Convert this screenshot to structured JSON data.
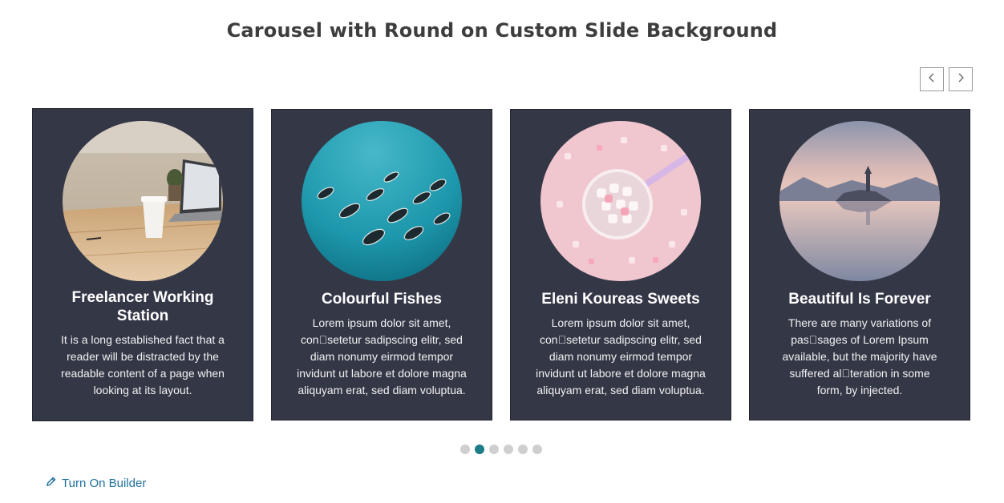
{
  "page": {
    "title": "Carousel with Round on Custom Slide Background"
  },
  "navigation": {
    "prev_icon": "chevron-left-icon",
    "next_icon": "chevron-right-icon"
  },
  "slides": [
    {
      "title": "Freelancer Working Station",
      "text": "It is a long established fact that a reader will be distracted by the readable content of a page when looking at its layout.",
      "image": "laptop-desk-photo"
    },
    {
      "title": "Colourful Fishes",
      "text": "Lorem ipsum dolor sit amet, con\u0000setetur sadipscing elitr, sed diam nonumy eirmod tempor invidunt ut labore et dolore magna aliquyam erat, sed diam voluptua.",
      "image": "fishes-underwater-photo"
    },
    {
      "title": "Eleni Koureas Sweets",
      "text": "Lorem ipsum dolor sit amet, con\u0000setetur sadipscing elitr, sed diam nonumy eirmod tempor invidunt ut labore et dolore magna aliquyam erat, sed diam voluptua.",
      "image": "marshmallow-cup-photo"
    },
    {
      "title": "Beautiful Is Forever",
      "text": "There are many variations of pas\u0000sages of Lorem Ipsum available, but the majority have suffered al\u0000teration in some form, by injected.",
      "image": "lake-island-photo"
    }
  ],
  "pagination": {
    "count": 6,
    "active_index": 1,
    "active_color": "#1d7d86",
    "inactive_color": "#cfcfcf"
  },
  "footer": {
    "builder_label": "Turn On Builder",
    "builder_icon": "pencil-icon",
    "link_color": "#1f6f9a"
  },
  "colors": {
    "slide_background": "#343746"
  }
}
